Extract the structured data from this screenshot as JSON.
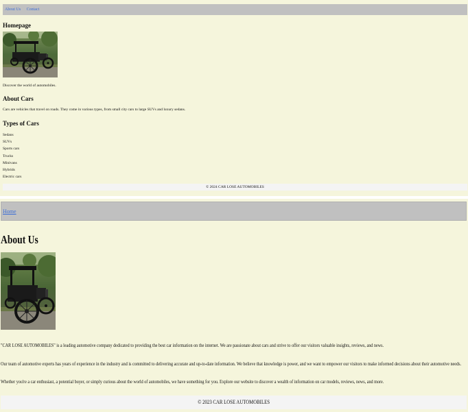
{
  "homepage": {
    "nav": {
      "links": [
        "About Us",
        "Contact"
      ]
    },
    "title": "Homepage",
    "tagline": "Discover the world of automobiles.",
    "about_cars": {
      "heading": "About Cars",
      "text": "Cars are vehicles that travel on roads. They come in various types, from small city cars to large SUVs and luxury sedans."
    },
    "types": {
      "heading": "Types of Cars",
      "items": [
        "Sedans",
        "SUVs",
        "Sports cars",
        "Trucks",
        "Minivans",
        "Hybrids",
        "Electric cars"
      ]
    },
    "footer": "© 2024 CAR LOSE AUTOMOBILES"
  },
  "about_page": {
    "nav": {
      "links": [
        "Home"
      ]
    },
    "title": "About Us",
    "paragraphs": [
      "\"CAR LOSE AUTOMOBILES\" is a leading automotive company dedicated to providing the best car information on the internet. We are passionate about cars and strive to offer our visitors valuable insights, reviews, and news.",
      "Our team of automotive experts has years of experience in the industry and is committed to delivering accurate and up-to-date information. We believe that knowledge is power, and we want to empower our visitors to make informed decisions about their automotive needs.",
      "Whether you're a car enthusiast, a potential buyer, or simply curious about the world of automobiles, we have something for you. Explore our website to discover a wealth of information on car models, reviews, news, and more."
    ],
    "footer": "© 2023 CAR LOSE AUTOMOBILES"
  },
  "colors": {
    "panel_bg": "#f5f5dc",
    "nav_bg": "#c0c0c0",
    "link": "#3d6fd6",
    "footer_bg": "#f4f4f4"
  },
  "images": {
    "car_photo": "vintage-black-car-photo"
  }
}
